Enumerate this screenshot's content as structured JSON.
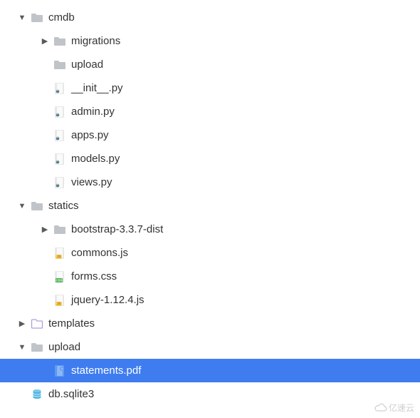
{
  "tree": [
    {
      "id": "cmdb",
      "label": "cmdb",
      "indent": 0,
      "arrow": "down",
      "icon": "folder",
      "selected": false
    },
    {
      "id": "migrations",
      "label": "migrations",
      "indent": 1,
      "arrow": "right",
      "icon": "folder",
      "selected": false
    },
    {
      "id": "upload-cmdb",
      "label": "upload",
      "indent": 1,
      "arrow": "none",
      "icon": "folder",
      "selected": false
    },
    {
      "id": "init-py",
      "label": "__init__.py",
      "indent": 1,
      "arrow": "none",
      "icon": "python",
      "selected": false
    },
    {
      "id": "admin-py",
      "label": "admin.py",
      "indent": 1,
      "arrow": "none",
      "icon": "python",
      "selected": false
    },
    {
      "id": "apps-py",
      "label": "apps.py",
      "indent": 1,
      "arrow": "none",
      "icon": "python",
      "selected": false
    },
    {
      "id": "models-py",
      "label": "models.py",
      "indent": 1,
      "arrow": "none",
      "icon": "python",
      "selected": false
    },
    {
      "id": "views-py",
      "label": "views.py",
      "indent": 1,
      "arrow": "none",
      "icon": "python",
      "selected": false
    },
    {
      "id": "statics",
      "label": "statics",
      "indent": 0,
      "arrow": "down",
      "icon": "folder",
      "selected": false
    },
    {
      "id": "bootstrap",
      "label": "bootstrap-3.3.7-dist",
      "indent": 1,
      "arrow": "right",
      "icon": "folder",
      "selected": false
    },
    {
      "id": "commons-js",
      "label": "commons.js",
      "indent": 1,
      "arrow": "none",
      "icon": "js",
      "selected": false
    },
    {
      "id": "forms-css",
      "label": "forms.css",
      "indent": 1,
      "arrow": "none",
      "icon": "css",
      "selected": false
    },
    {
      "id": "jquery-js",
      "label": "jquery-1.12.4.js",
      "indent": 1,
      "arrow": "none",
      "icon": "js",
      "selected": false
    },
    {
      "id": "templates",
      "label": "templates",
      "indent": 0,
      "arrow": "right",
      "icon": "folder-outline",
      "selected": false
    },
    {
      "id": "upload",
      "label": "upload",
      "indent": 0,
      "arrow": "down",
      "icon": "folder",
      "selected": false
    },
    {
      "id": "statements",
      "label": "statements.pdf",
      "indent": 1,
      "arrow": "none",
      "icon": "pdf",
      "selected": true
    },
    {
      "id": "db-sqlite3",
      "label": "db.sqlite3",
      "indent": 0,
      "arrow": "none",
      "icon": "database",
      "selected": false
    }
  ],
  "watermark": "亿速云"
}
